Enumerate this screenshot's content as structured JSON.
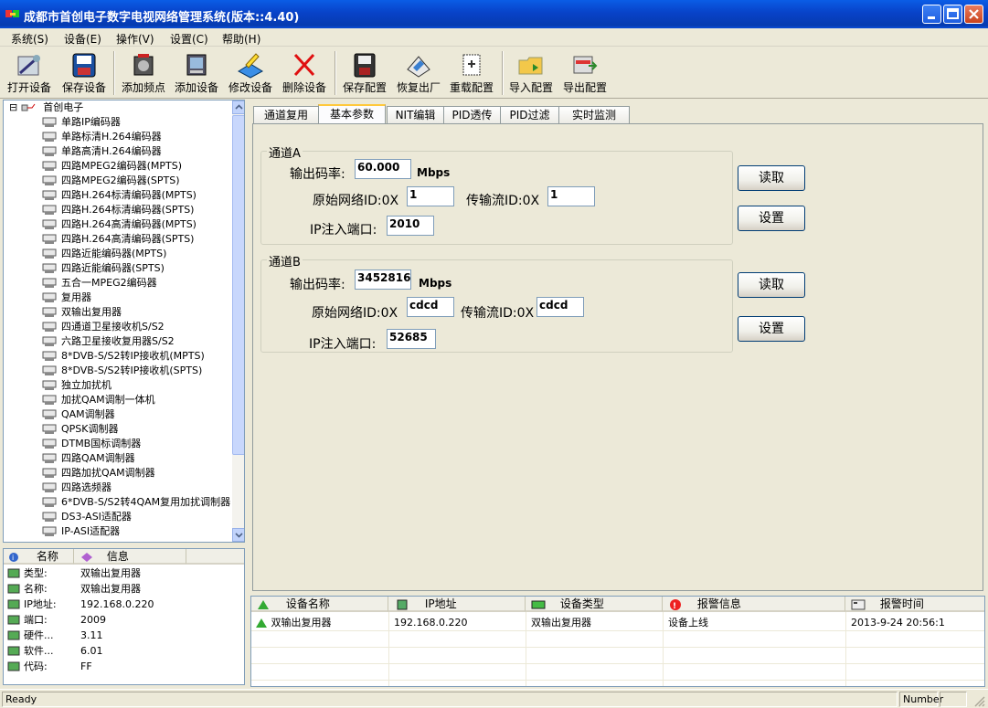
{
  "window": {
    "title": "成都市首创电子数字电视网络管理系统(版本::4.40)"
  },
  "menu": [
    {
      "label": "系统(S)"
    },
    {
      "label": "设备(E)"
    },
    {
      "label": "操作(V)"
    },
    {
      "label": "设置(C)"
    },
    {
      "label": "帮助(H)"
    }
  ],
  "toolbar": [
    {
      "label": "打开设备"
    },
    {
      "label": "保存设备"
    },
    {
      "label": "添加频点"
    },
    {
      "label": "添加设备"
    },
    {
      "label": "修改设备"
    },
    {
      "label": "删除设备"
    },
    {
      "label": "保存配置"
    },
    {
      "label": "恢复出厂"
    },
    {
      "label": "重载配置"
    },
    {
      "label": "导入配置"
    },
    {
      "label": "导出配置"
    }
  ],
  "tree": {
    "root": "首创电子",
    "expander": "⊟",
    "items": [
      "单路IP编码器",
      "单路标清H.264编码器",
      "单路高清H.264编码器",
      "四路MPEG2编码器(MPTS)",
      "四路MPEG2编码器(SPTS)",
      "四路H.264标清编码器(MPTS)",
      "四路H.264标清编码器(SPTS)",
      "四路H.264高清编码器(MPTS)",
      "四路H.264高清编码器(SPTS)",
      "四路近能编码器(MPTS)",
      "四路近能编码器(SPTS)",
      "五合一MPEG2编码器",
      "复用器",
      "双输出复用器",
      "四通道卫星接收机S/S2",
      "六路卫星接收复用器S/S2",
      "8*DVB-S/S2转IP接收机(MPTS)",
      "8*DVB-S/S2转IP接收机(SPTS)",
      "独立加扰机",
      "加扰QAM调制一体机",
      "QAM调制器",
      "QPSK调制器",
      "DTMB国标调制器",
      "四路QAM调制器",
      "四路加扰QAM调制器",
      "四路选频器",
      "6*DVB-S/S2转4QAM复用加扰调制器",
      "DS3-ASI适配器",
      "IP-ASI适配器"
    ]
  },
  "info": {
    "headers": [
      "名称",
      "信息"
    ],
    "rows": [
      {
        "key": "类型:",
        "value": "双输出复用器"
      },
      {
        "key": "名称:",
        "value": "双输出复用器"
      },
      {
        "key": "IP地址:",
        "value": "192.168.0.220"
      },
      {
        "key": "端口:",
        "value": "2009"
      },
      {
        "key": "硬件...",
        "value": "3.11"
      },
      {
        "key": "软件...",
        "value": "6.01"
      },
      {
        "key": "代码:",
        "value": "FF"
      }
    ]
  },
  "tabs": [
    {
      "label": "通道复用"
    },
    {
      "label": "基本参数"
    },
    {
      "label": "NIT编辑"
    },
    {
      "label": "PID透传"
    },
    {
      "label": "PID过滤"
    },
    {
      "label": "实时监测"
    }
  ],
  "channelA": {
    "title": "通道A",
    "rate_label": "输出码率:",
    "rate_value": "60.000",
    "rate_unit": "Mbps",
    "netid_label": "原始网络ID:0X",
    "netid_value": "1",
    "tsid_label": "传输流ID:0X",
    "tsid_value": "1",
    "port_label": "IP注入端口:",
    "port_value": "2010"
  },
  "channelB": {
    "title": "通道B",
    "rate_label": "输出码率:",
    "rate_value": "3452816.",
    "rate_unit": "Mbps",
    "netid_label": "原始网络ID:0X",
    "netid_value": "cdcd",
    "tsid_label": "传输流ID:0X",
    "tsid_value": "cdcd",
    "port_label": "IP注入端口:",
    "port_value": "52685"
  },
  "buttons": {
    "read": "读取",
    "set": "设置"
  },
  "alarm": {
    "headers": [
      "设备名称",
      "IP地址",
      "设备类型",
      "报警信息",
      "报警时间"
    ],
    "rows": [
      {
        "name": "双输出复用器",
        "ip": "192.168.0.220",
        "type": "双输出复用器",
        "msg": "设备上线",
        "time": "2013-9-24 20:56:1"
      }
    ]
  },
  "status": {
    "left": "Ready",
    "right": "Number"
  }
}
